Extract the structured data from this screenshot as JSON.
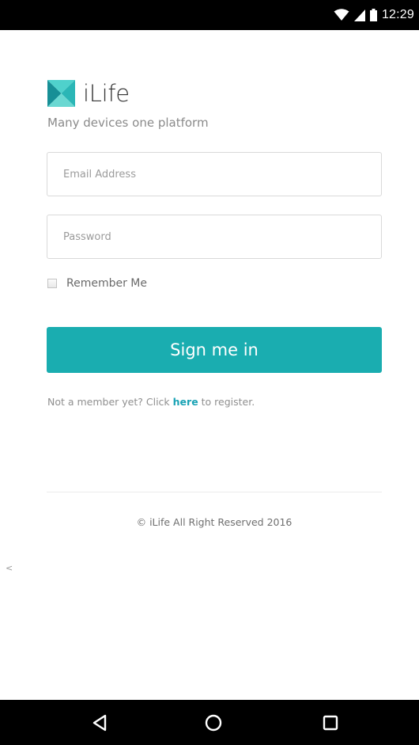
{
  "status_bar": {
    "time": "12:29",
    "icons": [
      "wifi-icon",
      "cellular-signal-icon",
      "battery-icon"
    ]
  },
  "brand": {
    "name": "iLife",
    "tagline": "Many devices one platform",
    "logo_icon": "ilife-logo-icon",
    "logo_colors": [
      "#2bb6b6",
      "#4fd1cc",
      "#178f96",
      "#6ad8d2"
    ]
  },
  "form": {
    "email_placeholder": "Email Address",
    "password_placeholder": "Password",
    "remember_label": "Remember Me",
    "remember_checked": false,
    "submit_label": "Sign me in"
  },
  "register": {
    "prefix": "Not a member yet? Click ",
    "link_text": "here",
    "suffix": " to register."
  },
  "footer": {
    "copyright": "© iLife All Right Reserved 2016"
  },
  "edge_marker": "<",
  "nav_bar": {
    "icons": [
      "back-triangle-icon",
      "home-circle-icon",
      "recents-square-icon"
    ]
  },
  "colors": {
    "accent": "#1aadb0",
    "link": "#1aa3b5",
    "status_bar": "#000000",
    "nav_bar": "#000000"
  }
}
